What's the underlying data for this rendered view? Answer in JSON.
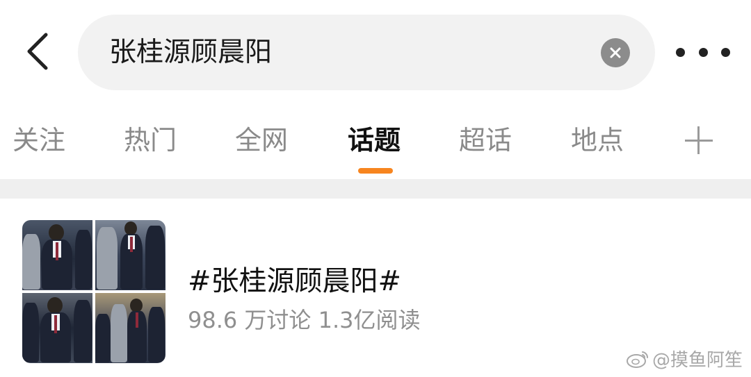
{
  "search": {
    "query": "张桂源顾晨阳",
    "back_icon": "back-arrow-icon",
    "clear_icon": "clear-icon",
    "more_icon": "more-dots-icon"
  },
  "tabs": [
    {
      "label": "关注",
      "active": false
    },
    {
      "label": "热门",
      "active": false
    },
    {
      "label": "全网",
      "active": false
    },
    {
      "label": "话题",
      "active": true
    },
    {
      "label": "超话",
      "active": false
    },
    {
      "label": "地点",
      "active": false
    }
  ],
  "tab_add_icon": "plus-icon",
  "colors": {
    "accent": "#f7851f",
    "search_bg": "#f2f2f2",
    "separator": "#efefef",
    "muted_text": "#8f8f8f"
  },
  "result": {
    "title": "#张桂源顾晨阳#",
    "meta": "98.6 万讨论 1.3亿阅读",
    "thumbnail": "topic-collage-thumbnail"
  },
  "watermark": {
    "text": "@摸鱼阿笙",
    "icon": "weibo-logo-icon"
  }
}
